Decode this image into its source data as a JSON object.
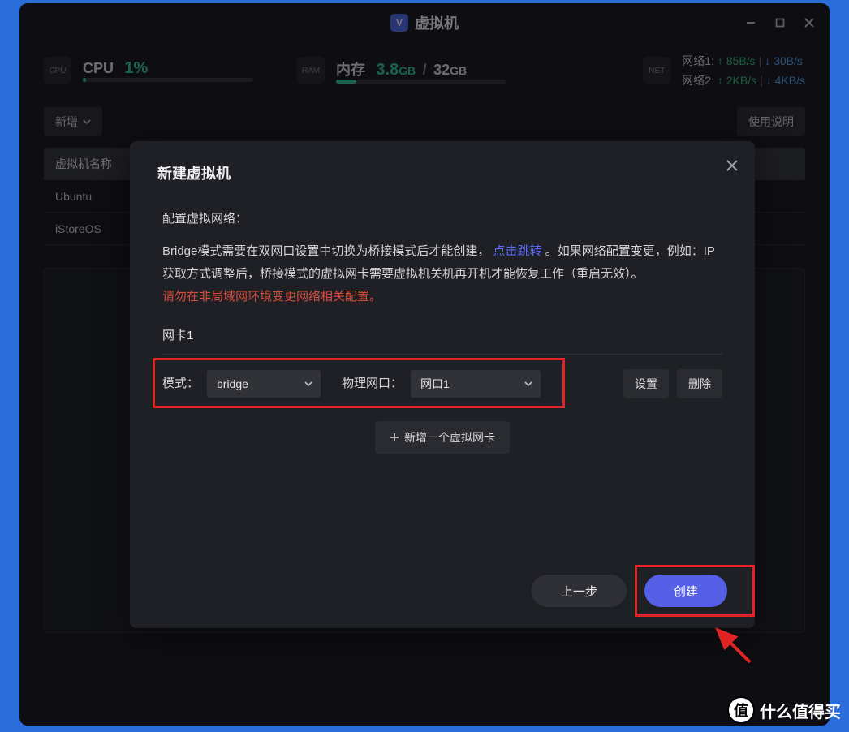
{
  "titlebar": {
    "title": "虚拟机",
    "logo_letter": "V"
  },
  "stats": {
    "cpu": {
      "label": "CPU",
      "value": "1%",
      "fill_pct": 2
    },
    "mem": {
      "label": "内存",
      "used": "3.8",
      "used_unit": "GB",
      "total": "32",
      "total_unit": "GB",
      "fill_pct": 12
    },
    "net": [
      {
        "name": "网络1:",
        "up": "85B/s",
        "down": "30B/s"
      },
      {
        "name": "网络2:",
        "up": "2KB/s",
        "down": "4KB/s"
      }
    ]
  },
  "toolbar": {
    "add": "新增",
    "help": "使用说明"
  },
  "table": {
    "header": "虚拟机名称",
    "rows": [
      "Ubuntu",
      "iStoreOS"
    ]
  },
  "modal": {
    "title": "新建虚拟机",
    "section_cfg": "配置虚拟网络：",
    "desc_a": "Bridge模式需要在双网口设置中切换为桥接模式后才能创建，",
    "link": "点击跳转",
    "desc_b": " 。如果网络配置变更，例如：IP获取方式调整后，桥接模式的虚拟网卡需要虚拟机关机再开机才能恢复工作（重启无效）。",
    "warn": "请勿在非局域网环境变更网络相关配置。",
    "nic_label": "网卡1",
    "mode_label": "模式：",
    "mode_value": "bridge",
    "port_label": "物理网口：",
    "port_value": "网口1",
    "btn_set": "设置",
    "btn_del": "删除",
    "btn_add_nic": "新增一个虚拟网卡",
    "btn_prev": "上一步",
    "btn_create": "创建"
  },
  "watermark": {
    "char": "值",
    "text": "什么值得买"
  }
}
